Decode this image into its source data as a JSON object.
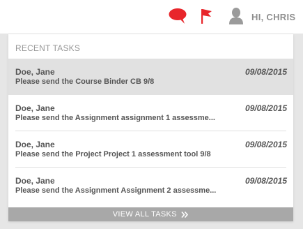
{
  "header": {
    "icons": [
      "chat-bubble-icon",
      "flag-icon",
      "user-icon"
    ],
    "greeting": "HI, CHRIS"
  },
  "tasks_panel": {
    "title": "RECENT TASKS",
    "items": [
      {
        "name": "Doe, Jane",
        "date": "09/08/2015",
        "description": "Please send the Course Binder CB 9/8",
        "highlighted": true
      },
      {
        "name": "Doe, Jane",
        "date": "09/08/2015",
        "description": "Please send the Assignment assignment 1 assessme...",
        "highlighted": false
      },
      {
        "name": "Doe, Jane",
        "date": "09/08/2015",
        "description": "Please send the Project Project 1 assessment tool 9/8",
        "highlighted": false
      },
      {
        "name": "Doe, Jane",
        "date": "09/08/2015",
        "description": "Please send the Assignment Assignment 2 assessme...",
        "highlighted": false
      }
    ],
    "footer_label": "VIEW ALL TASKS",
    "footer_icon": "double-chevron-right-icon"
  },
  "colors": {
    "accent_red": "#e8262b",
    "icon_gray": "#9b9b9b",
    "footer_bg": "#a8a8a8",
    "highlight_bg": "#e1e1e1"
  }
}
